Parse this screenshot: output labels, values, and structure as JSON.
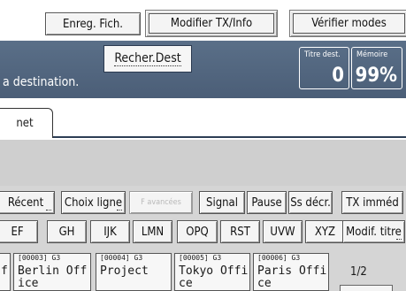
{
  "toolbar": {
    "enreg_fich": "Enreg. Fich.",
    "modifier_tx": "Modifier TX/Info",
    "verifier_modes": "Vérifier modes"
  },
  "status": {
    "recher_dest": "Recher.Dest",
    "message": "a destination.",
    "titre_dest_label": "Titre dest.",
    "titre_dest_value": "0",
    "memoire_label": "Mémoire",
    "memoire_value": "99%"
  },
  "tab": {
    "label": "net"
  },
  "function_row": {
    "recent": "Récent",
    "choix_ligne": "Choix ligne",
    "f_avancees": "F avancées",
    "signal": "Signal",
    "pause": "Pause",
    "ss_decr": "Ss décr.",
    "tx_immed": "TX imméd"
  },
  "index_tabs": [
    "EF",
    "GH",
    "IJK",
    "LMN",
    "OPQ",
    "RST",
    "UVW",
    "XYZ"
  ],
  "modif_titre": "Modif. titre",
  "destinations": [
    {
      "code": "",
      "name": "f"
    },
    {
      "code": "[00003] G3",
      "name": "Berlin Off\nice"
    },
    {
      "code": "[00004] G3",
      "name": "Project"
    },
    {
      "code": "[00005] G3",
      "name": "Tokyo Offi\nce"
    },
    {
      "code": "[00006] G3",
      "name": "Paris Offi\nce"
    }
  ],
  "pagination": "1/2"
}
